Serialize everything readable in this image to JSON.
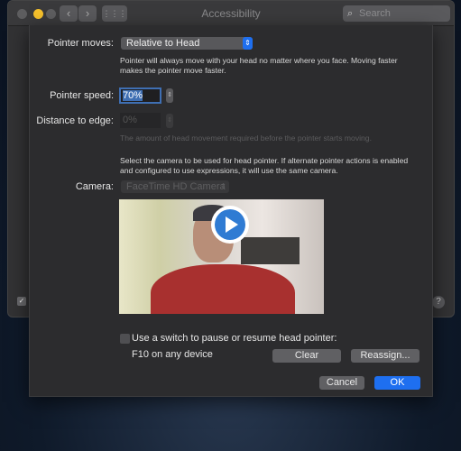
{
  "window": {
    "title": "Accessibility",
    "search_placeholder": "Search",
    "help": "?"
  },
  "sheet": {
    "pointer_moves": {
      "label": "Pointer moves:",
      "value": "Relative to Head",
      "description_line1": "Pointer will always move with your head no matter where you face. Moving faster",
      "description_line2": "makes the pointer move faster."
    },
    "pointer_speed": {
      "label": "Pointer speed:",
      "value": "70%"
    },
    "distance_to_edge": {
      "label": "Distance to edge:",
      "value": "0%",
      "description": "The amount of head movement required before the pointer starts moving."
    },
    "camera_description_line1": "Select the camera to be used for head pointer. If alternate pointer actions is enabled",
    "camera_description_line2": "and configured to use expressions, it will use the same camera.",
    "camera": {
      "label": "Camera:",
      "value": "FaceTime HD Camera"
    },
    "switch": {
      "label": "Use a switch to pause or resume head pointer:",
      "checked": false,
      "assignment": "F10 on any device",
      "clear": "Clear",
      "reassign": "Reassign..."
    },
    "cancel": "Cancel",
    "ok": "OK"
  },
  "colors": {
    "accent": "#1e6ff0",
    "sheet_bg": "#2c2c2e"
  }
}
